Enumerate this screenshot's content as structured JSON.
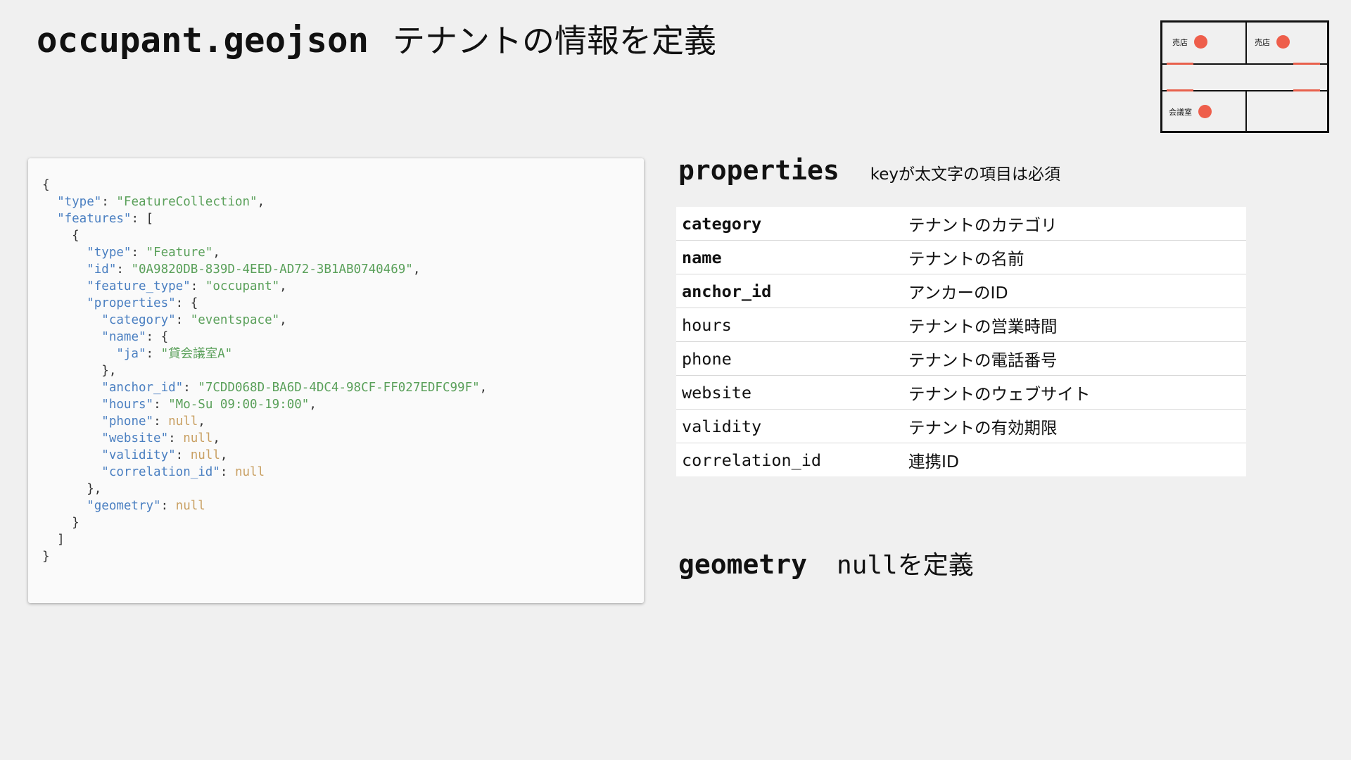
{
  "title": {
    "code": "occupant.geojson",
    "description": "テナントの情報を定義"
  },
  "floorplan": {
    "rooms": [
      {
        "label": "売店"
      },
      {
        "label": "売店"
      },
      {
        "label": "会議室"
      }
    ],
    "accent_color": "#ee5e4b"
  },
  "code": {
    "lines": [
      [
        [
          "p",
          "{"
        ]
      ],
      [
        [
          "p",
          "  "
        ],
        [
          "k",
          "\"type\""
        ],
        [
          "p",
          ": "
        ],
        [
          "s",
          "\"FeatureCollection\""
        ],
        [
          "p",
          ","
        ]
      ],
      [
        [
          "p",
          "  "
        ],
        [
          "k",
          "\"features\""
        ],
        [
          "p",
          ": ["
        ]
      ],
      [
        [
          "p",
          "    {"
        ]
      ],
      [
        [
          "p",
          "      "
        ],
        [
          "k",
          "\"type\""
        ],
        [
          "p",
          ": "
        ],
        [
          "s",
          "\"Feature\""
        ],
        [
          "p",
          ","
        ]
      ],
      [
        [
          "p",
          "      "
        ],
        [
          "k",
          "\"id\""
        ],
        [
          "p",
          ": "
        ],
        [
          "s",
          "\"0A9820DB-839D-4EED-AD72-3B1AB0740469\""
        ],
        [
          "p",
          ","
        ]
      ],
      [
        [
          "p",
          "      "
        ],
        [
          "k",
          "\"feature_type\""
        ],
        [
          "p",
          ": "
        ],
        [
          "s",
          "\"occupant\""
        ],
        [
          "p",
          ","
        ]
      ],
      [
        [
          "p",
          "      "
        ],
        [
          "k",
          "\"properties\""
        ],
        [
          "p",
          ": {"
        ]
      ],
      [
        [
          "p",
          "        "
        ],
        [
          "k",
          "\"category\""
        ],
        [
          "p",
          ": "
        ],
        [
          "s",
          "\"eventspace\""
        ],
        [
          "p",
          ","
        ]
      ],
      [
        [
          "p",
          "        "
        ],
        [
          "k",
          "\"name\""
        ],
        [
          "p",
          ": {"
        ]
      ],
      [
        [
          "p",
          "          "
        ],
        [
          "k",
          "\"ja\""
        ],
        [
          "p",
          ": "
        ],
        [
          "s",
          "\"貸会議室A\""
        ]
      ],
      [
        [
          "p",
          "        },"
        ]
      ],
      [
        [
          "p",
          "        "
        ],
        [
          "k",
          "\"anchor_id\""
        ],
        [
          "p",
          ": "
        ],
        [
          "s",
          "\"7CDD068D-BA6D-4DC4-98CF-FF027EDFC99F\""
        ],
        [
          "p",
          ","
        ]
      ],
      [
        [
          "p",
          "        "
        ],
        [
          "k",
          "\"hours\""
        ],
        [
          "p",
          ": "
        ],
        [
          "s",
          "\"Mo-Su 09:00-19:00\""
        ],
        [
          "p",
          ","
        ]
      ],
      [
        [
          "p",
          "        "
        ],
        [
          "k",
          "\"phone\""
        ],
        [
          "p",
          ": "
        ],
        [
          "n",
          "null"
        ],
        [
          "p",
          ","
        ]
      ],
      [
        [
          "p",
          "        "
        ],
        [
          "k",
          "\"website\""
        ],
        [
          "p",
          ": "
        ],
        [
          "n",
          "null"
        ],
        [
          "p",
          ","
        ]
      ],
      [
        [
          "p",
          "        "
        ],
        [
          "k",
          "\"validity\""
        ],
        [
          "p",
          ": "
        ],
        [
          "n",
          "null"
        ],
        [
          "p",
          ","
        ]
      ],
      [
        [
          "p",
          "        "
        ],
        [
          "k",
          "\"correlation_id\""
        ],
        [
          "p",
          ": "
        ],
        [
          "n",
          "null"
        ]
      ],
      [
        [
          "p",
          "      },"
        ]
      ],
      [
        [
          "p",
          "      "
        ],
        [
          "k",
          "\"geometry\""
        ],
        [
          "p",
          ": "
        ],
        [
          "n",
          "null"
        ]
      ],
      [
        [
          "p",
          "    }"
        ]
      ],
      [
        [
          "p",
          "  ]"
        ]
      ],
      [
        [
          "p",
          "}"
        ]
      ]
    ]
  },
  "properties": {
    "title": "properties",
    "note": "keyが太文字の項目は必須",
    "rows": [
      {
        "key": "category",
        "desc": "テナントのカテゴリ",
        "required": true
      },
      {
        "key": "name",
        "desc": "テナントの名前",
        "required": true
      },
      {
        "key": "anchor_id",
        "desc": "アンカーのID",
        "required": true
      },
      {
        "key": "hours",
        "desc": "テナントの営業時間",
        "required": false
      },
      {
        "key": "phone",
        "desc": "テナントの電話番号",
        "required": false
      },
      {
        "key": "website",
        "desc": "テナントのウェブサイト",
        "required": false
      },
      {
        "key": "validity",
        "desc": "テナントの有効期限",
        "required": false
      },
      {
        "key": "correlation_id",
        "desc": "連携ID",
        "required": false
      }
    ]
  },
  "geometry": {
    "title": "geometry",
    "description": "nullを定義"
  }
}
